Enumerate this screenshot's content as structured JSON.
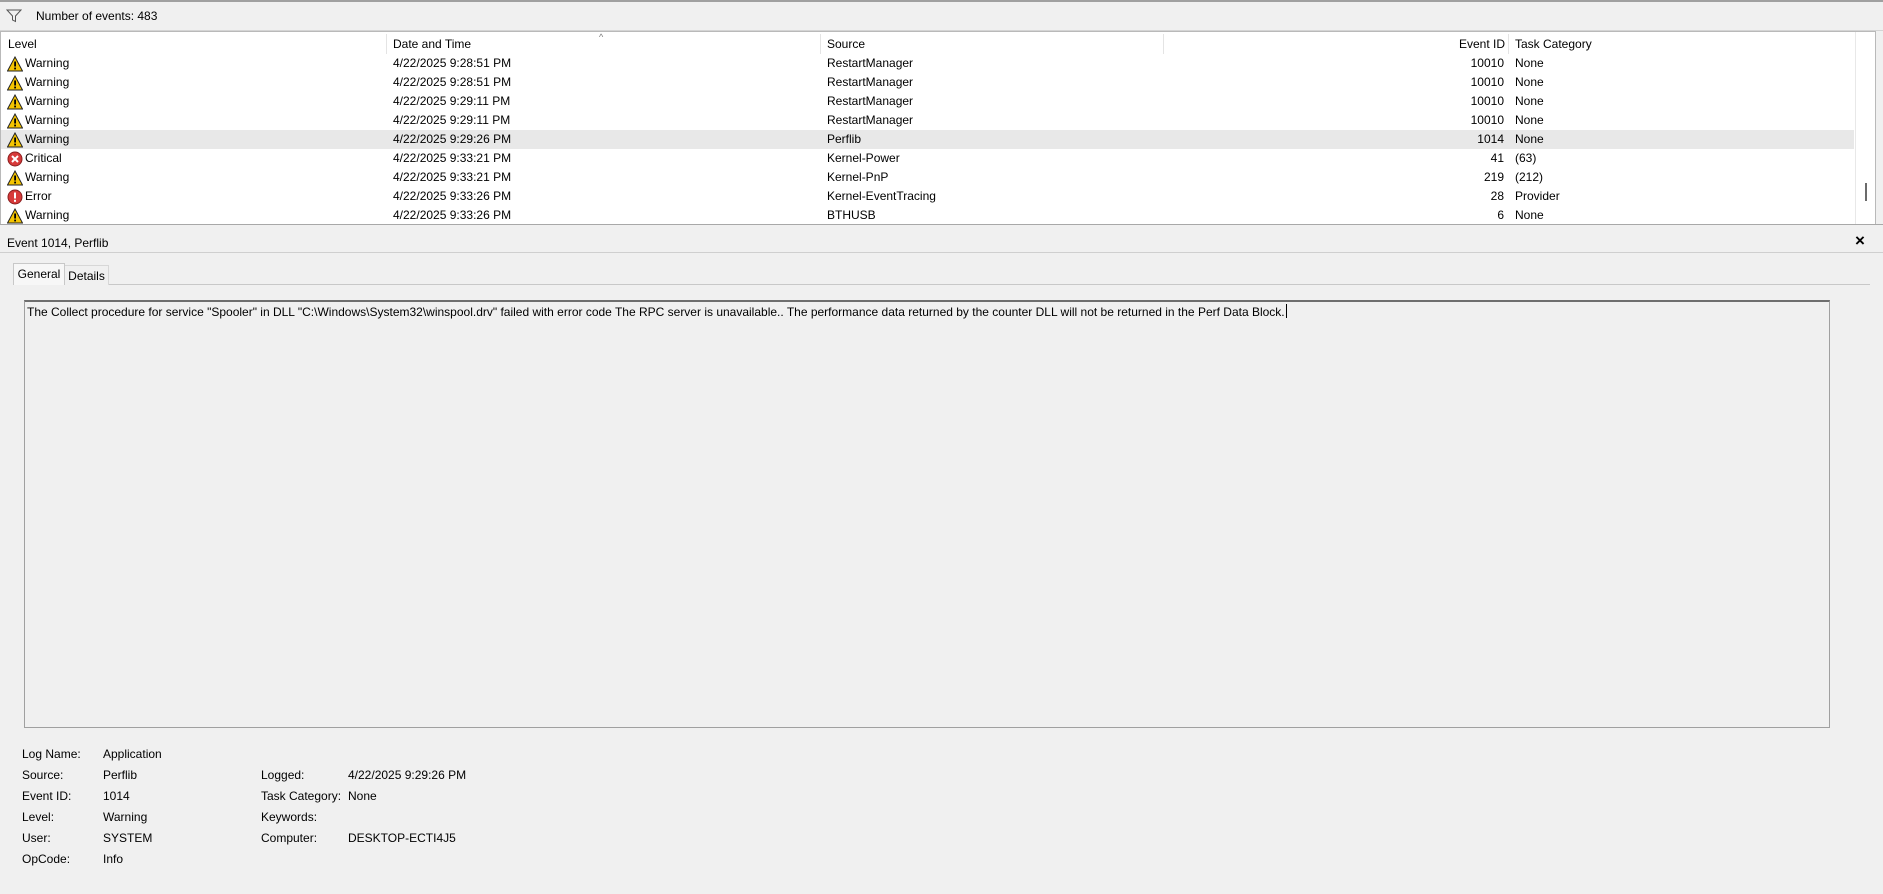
{
  "summary": {
    "count_label": "Number of events: 483",
    "filter_icon": "filter-icon"
  },
  "columns": {
    "level": "Level",
    "date": "Date and Time",
    "source": "Source",
    "event_id": "Event ID",
    "task_category": "Task Category"
  },
  "events": [
    {
      "level": "Warning",
      "icon": "warning-icon",
      "date": "4/22/2025 9:28:51 PM",
      "source": "RestartManager",
      "event_id": "10010",
      "category": "None"
    },
    {
      "level": "Warning",
      "icon": "warning-icon",
      "date": "4/22/2025 9:28:51 PM",
      "source": "RestartManager",
      "event_id": "10010",
      "category": "None"
    },
    {
      "level": "Warning",
      "icon": "warning-icon",
      "date": "4/22/2025 9:29:11 PM",
      "source": "RestartManager",
      "event_id": "10010",
      "category": "None"
    },
    {
      "level": "Warning",
      "icon": "warning-icon",
      "date": "4/22/2025 9:29:11 PM",
      "source": "RestartManager",
      "event_id": "10010",
      "category": "None"
    },
    {
      "level": "Warning",
      "icon": "warning-icon",
      "date": "4/22/2025 9:29:26 PM",
      "source": "Perflib",
      "event_id": "1014",
      "category": "None",
      "selected": true
    },
    {
      "level": "Critical",
      "icon": "critical-icon",
      "date": "4/22/2025 9:33:21 PM",
      "source": "Kernel-Power",
      "event_id": "41",
      "category": "(63)"
    },
    {
      "level": "Warning",
      "icon": "warning-icon",
      "date": "4/22/2025 9:33:21 PM",
      "source": "Kernel-PnP",
      "event_id": "219",
      "category": "(212)"
    },
    {
      "level": "Error",
      "icon": "error-icon",
      "date": "4/22/2025 9:33:26 PM",
      "source": "Kernel-EventTracing",
      "event_id": "28",
      "category": "Provider"
    },
    {
      "level": "Warning",
      "icon": "warning-icon",
      "date": "4/22/2025 9:33:26 PM",
      "source": "BTHUSB",
      "event_id": "6",
      "category": "None"
    }
  ],
  "detail": {
    "title": "Event 1014, Perflib",
    "close_label": "×",
    "tabs": [
      "General",
      "Details"
    ],
    "description": "The Collect procedure for service \"Spooler\" in DLL \"C:\\Windows\\System32\\winspool.drv\" failed with error code The RPC server is unavailable.. The performance data returned by the counter DLL will not be returned in the Perf Data Block.",
    "properties": {
      "log_name_label": "Log Name:",
      "log_name": "Application",
      "source_label": "Source:",
      "source": "Perflib",
      "logged_label": "Logged:",
      "logged": "4/22/2025 9:29:26 PM",
      "event_id_label": "Event ID:",
      "event_id": "1014",
      "task_category_label": "Task Category:",
      "task_category": "None",
      "level_label": "Level:",
      "level": "Warning",
      "keywords_label": "Keywords:",
      "keywords": "",
      "user_label": "User:",
      "user": "SYSTEM",
      "computer_label": "Computer:",
      "computer": "DESKTOP-ECTI4J5",
      "opcode_label": "OpCode:",
      "opcode": "Info"
    }
  }
}
